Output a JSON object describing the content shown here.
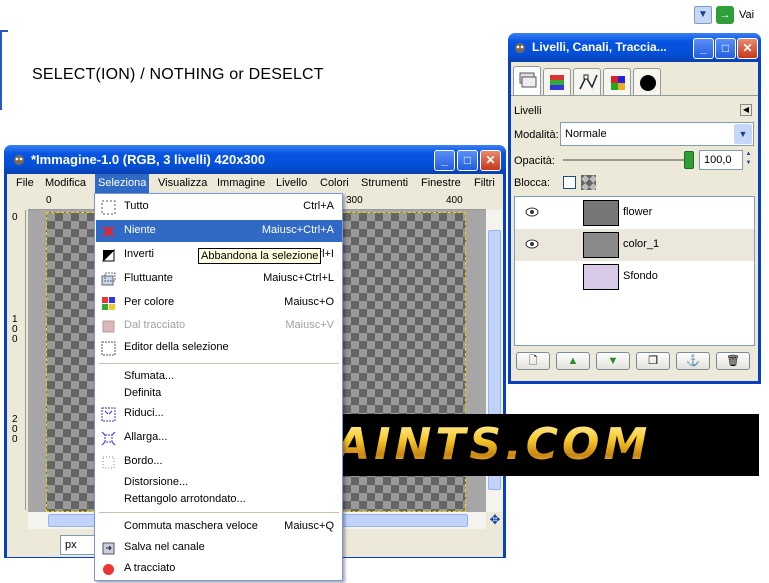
{
  "browser": {
    "go_label": "Vai"
  },
  "heading": "SELECT(ION) / NOTHING or DESELCT",
  "image_window": {
    "title": "*Immagine-1.0 (RGB, 3 livelli) 420x300",
    "menus": [
      "File",
      "Modifica",
      "Seleziona",
      "Visualizza",
      "Immagine",
      "Livello",
      "Colori",
      "Strumenti",
      "Finestre",
      "Filtri"
    ],
    "active_menu": "Seleziona",
    "ruler_h": [
      "0",
      "300",
      "400"
    ],
    "ruler_v": [
      "0",
      "1",
      "0",
      "0",
      "2",
      "0",
      "0"
    ],
    "unit": "px"
  },
  "select_menu": {
    "items": [
      {
        "label": "Tutto",
        "shortcut": "Ctrl+A",
        "icon": "select-all-icon"
      },
      {
        "label": "Niente",
        "shortcut": "Maiusc+Ctrl+A",
        "icon": "select-none-icon"
      },
      {
        "label": "Inverti",
        "shortcut": "Ctrl+I",
        "icon": "invert-icon"
      },
      {
        "label": "Fluttuante",
        "shortcut": "Maiusc+Ctrl+L",
        "icon": "float-icon"
      },
      {
        "label": "Per colore",
        "shortcut": "Maiusc+O",
        "icon": "by-color-icon"
      },
      {
        "label": "Dal tracciato",
        "shortcut": "Maiusc+V",
        "icon": "from-path-icon"
      },
      {
        "label": "Editor della selezione",
        "shortcut": "",
        "icon": "selection-editor-icon"
      },
      {
        "label": "Sfumata...",
        "shortcut": "",
        "icon": ""
      },
      {
        "label": "Definita",
        "shortcut": "",
        "icon": ""
      },
      {
        "label": "Riduci...",
        "shortcut": "",
        "icon": "shrink-icon"
      },
      {
        "label": "Allarga...",
        "shortcut": "",
        "icon": "grow-icon"
      },
      {
        "label": "Bordo...",
        "shortcut": "",
        "icon": "border-icon"
      },
      {
        "label": "Distorsione...",
        "shortcut": "",
        "icon": ""
      },
      {
        "label": "Rettangolo arrotondato...",
        "shortcut": "",
        "icon": ""
      },
      {
        "label": "Commuta maschera veloce",
        "shortcut": "Maiusc+Q",
        "icon": ""
      },
      {
        "label": "Salva nel canale",
        "shortcut": "",
        "icon": "save-channel-icon"
      },
      {
        "label": "A tracciato",
        "shortcut": "",
        "icon": "to-path-icon"
      }
    ],
    "tooltip": "Abbandona la selezione"
  },
  "layers_dock": {
    "title": "Livelli, Canali, Traccia...",
    "panel_label": "Livelli",
    "mode_label": "Modalità:",
    "mode_value": "Normale",
    "opacity_label": "Opacità:",
    "opacity_value": "100,0",
    "opacity_fraction": 1.0,
    "lock_label": "Blocca:",
    "layers": [
      {
        "name": "flower",
        "visible": true
      },
      {
        "name": "color_1",
        "visible": true
      },
      {
        "name": "Sfondo",
        "visible": false
      }
    ]
  },
  "banner": {
    "text": "KAINTS.com"
  },
  "colors": {
    "xp_blue": "#0450d8",
    "highlight": "#316ac5",
    "tooltip_bg": "#ffffe1"
  }
}
